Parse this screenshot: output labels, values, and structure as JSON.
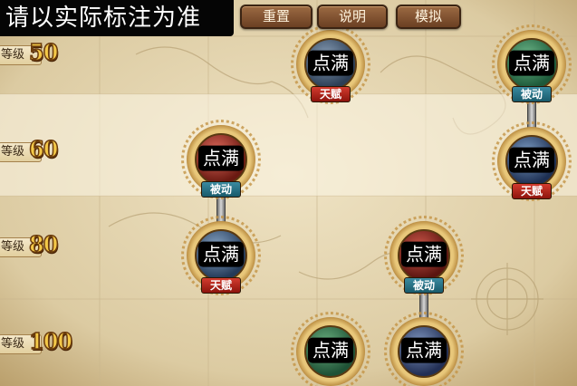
{
  "notice": "请以实际标注为准",
  "buttons": {
    "reset": "重置",
    "info": "说明",
    "simulate": "模拟"
  },
  "levels": [
    {
      "tag": "等级",
      "value": "50"
    },
    {
      "tag": "等级",
      "value": "60"
    },
    {
      "tag": "等级",
      "value": "80"
    },
    {
      "tag": "等级",
      "value": "100"
    }
  ],
  "nodes": {
    "lv50_col3": {
      "label": "点满",
      "badge": "天赋"
    },
    "lv50_col5": {
      "label": "点满",
      "badge": "被动"
    },
    "lv60_col2": {
      "label": "点满",
      "badge": "被动"
    },
    "lv60_col5": {
      "label": "点满",
      "badge": "天赋"
    },
    "lv80_col2": {
      "label": "点满",
      "badge": "天赋"
    },
    "lv80_col4": {
      "label": "点满",
      "badge": "被动"
    },
    "lv100_col3": {
      "label": "点满"
    },
    "lv100_col4": {
      "label": "点满"
    }
  },
  "colors": {
    "talent_badge": "#b1231a",
    "passive_badge": "#2a7386",
    "button": "#7d4b2a",
    "level_number": "#f4c948"
  }
}
